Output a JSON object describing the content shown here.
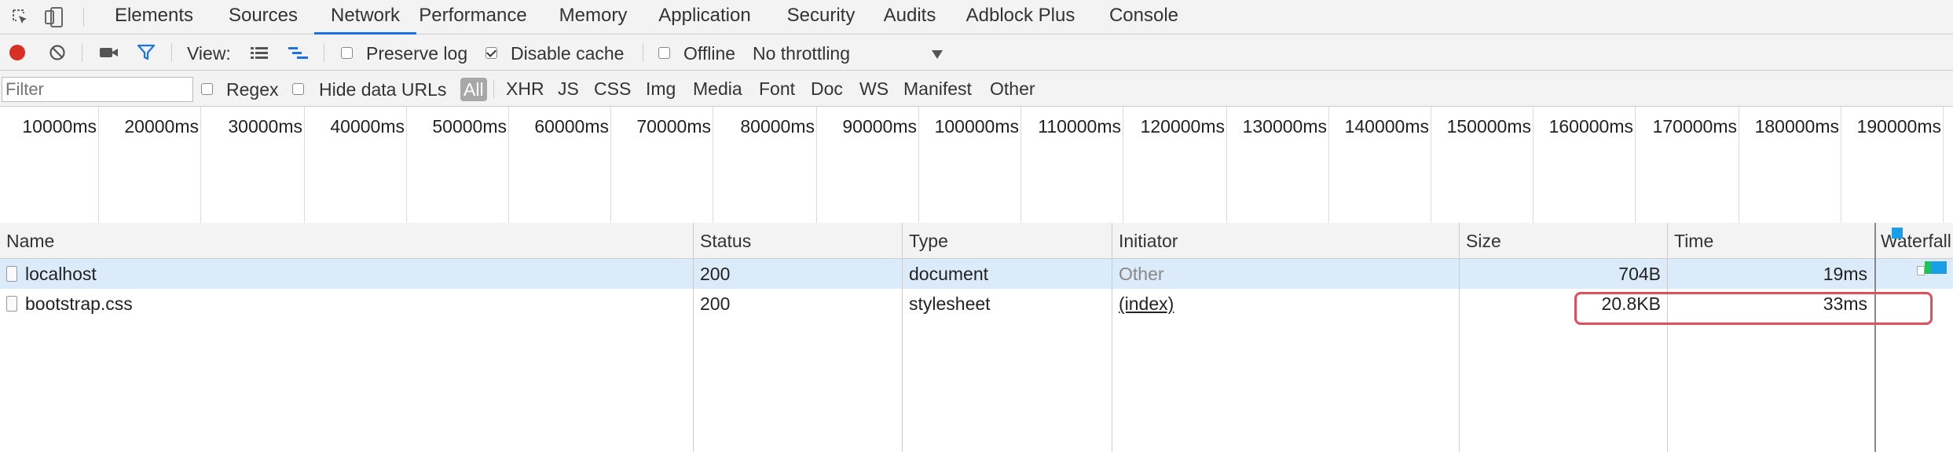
{
  "tabs": [
    "Elements",
    "Sources",
    "Network",
    "Performance",
    "Memory",
    "Application",
    "Security",
    "Audits",
    "Adblock Plus",
    "Console"
  ],
  "active_tab": "Network",
  "toolbar": {
    "view_label": "View:",
    "preserve_log": "Preserve log",
    "preserve_log_checked": false,
    "disable_cache": "Disable cache",
    "disable_cache_checked": true,
    "offline": "Offline",
    "offline_checked": false,
    "throttling": "No throttling"
  },
  "filter": {
    "placeholder": "Filter",
    "regex": "Regex",
    "hide_data_urls": "Hide data URLs",
    "all": "All",
    "types": [
      "XHR",
      "JS",
      "CSS",
      "Img",
      "Media",
      "Font",
      "Doc",
      "WS",
      "Manifest",
      "Other"
    ]
  },
  "overview_ticks": [
    "10000ms",
    "20000ms",
    "30000ms",
    "40000ms",
    "50000ms",
    "60000ms",
    "70000ms",
    "80000ms",
    "90000ms",
    "100000ms",
    "110000ms",
    "120000ms",
    "130000ms",
    "140000ms",
    "150000ms",
    "160000ms",
    "170000ms",
    "180000ms",
    "190000ms"
  ],
  "columns": {
    "name": "Name",
    "status": "Status",
    "type": "Type",
    "initiator": "Initiator",
    "size": "Size",
    "time": "Time",
    "waterfall": "Waterfall"
  },
  "rows": [
    {
      "name": "localhost",
      "status": "200",
      "type": "document",
      "initiator": "Other",
      "size": "704B",
      "time": "19ms"
    },
    {
      "name": "bootstrap.css",
      "status": "200",
      "type": "stylesheet",
      "initiator": "(index)",
      "size": "20.8KB",
      "time": "33ms"
    }
  ],
  "colors": {
    "record": "#d93025",
    "filter_active": "#1a73e8",
    "highlight": "#e0505a",
    "selected_row": "#dcebfa"
  }
}
